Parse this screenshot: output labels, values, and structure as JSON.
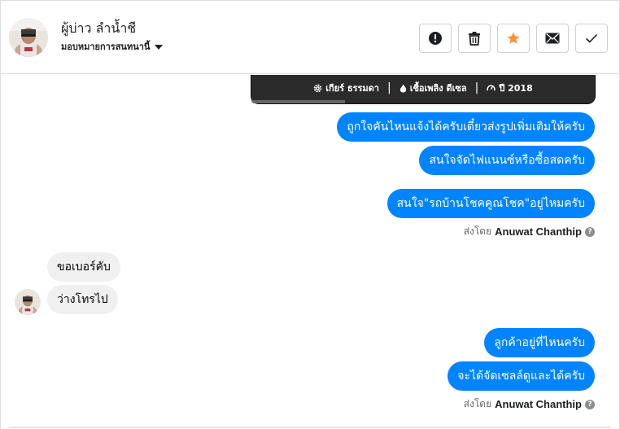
{
  "header": {
    "contact_name": "ผู้บ่าว ลำน้ำชี",
    "assign_label": "มอบหมายการสนทนานี้",
    "actions": [
      {
        "icon": "alert-icon"
      },
      {
        "icon": "trash-icon"
      },
      {
        "icon": "star-icon"
      },
      {
        "icon": "mail-icon"
      },
      {
        "icon": "check-icon"
      }
    ]
  },
  "card": {
    "gear": "เกียร์ ธรรมดา",
    "fuel": "เชื้อเพลิง ดีเซล",
    "year": "ปี 2018"
  },
  "messages": {
    "out_1": "ถูกใจคันไหนแจ้งได้ครับเดี๋ยวส่งรูปเพิ่มเติมให้ครับ",
    "out_2": "สนใจจัดไฟแนนซ์หรือซื้อสดครับ",
    "out_3": "สนใจ\"รถบ้านโชคคูณโชค\"อยู่ไหมครับ",
    "in_1": "ขอเบอร์คับ",
    "in_2": "ว่างโทรไป",
    "out_4": "ลูกค้าอยู่ที่ไหนครับ",
    "out_5": "จะได้จัดเซลล์ดูและได้ครับ"
  },
  "sent_by": {
    "prefix": "ส่งโดย",
    "name": "Anuwat Chanthip",
    "help": "?"
  },
  "colors": {
    "outgoing_bubble": "#0084ff",
    "incoming_bubble": "#f0f0f0",
    "star": "#f7923b"
  }
}
